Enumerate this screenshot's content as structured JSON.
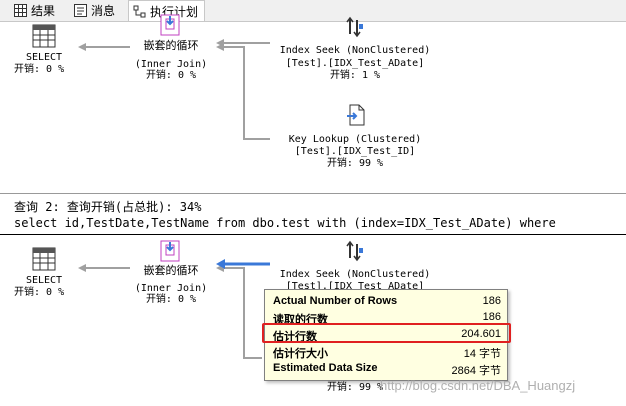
{
  "tabs": [
    {
      "label": "结果",
      "icon": "grid-icon"
    },
    {
      "label": "消息",
      "icon": "message-icon"
    },
    {
      "label": "执行计划",
      "icon": "plan-icon"
    }
  ],
  "plan1": {
    "select": {
      "title": "SELECT",
      "cost": "开销: 0 %"
    },
    "loop": {
      "title": "嵌套的循环",
      "sub": "(Inner Join)",
      "cost": "开销: 0 %"
    },
    "seek": {
      "title": "Index Seek (NonClustered)",
      "object": "[Test].[IDX_Test_ADate]",
      "cost": "开销: 1 %"
    },
    "lookup": {
      "title": "Key Lookup (Clustered)",
      "object": "[Test].[IDX_Test_ID]",
      "cost": "开销: 99 %"
    }
  },
  "query2": {
    "header": "查询 2: 查询开销(占总批): 34%",
    "sql": "select id,TestDate,TestName from dbo.test with (index=IDX_Test_ADate) where"
  },
  "plan2": {
    "select": {
      "title": "SELECT",
      "cost": "开销: 0 %"
    },
    "loop": {
      "title": "嵌套的循环",
      "sub": "(Inner Join)",
      "cost": "开销: 0 %"
    },
    "seek": {
      "title": "Index Seek (NonClustered)",
      "object_partial": "[Test].[IDX_Test_ADate]"
    },
    "lookup": {
      "cost": "开销: 99 %"
    }
  },
  "tooltip": {
    "rows": [
      {
        "key": "Actual Number of Rows",
        "value": "186"
      },
      {
        "key": "读取的行数",
        "value": "186"
      },
      {
        "key": "估计行数",
        "value": "204.601"
      },
      {
        "key": "估计行大小",
        "value": "14 字节"
      },
      {
        "key": "Estimated Data Size",
        "value": "2864 字节"
      }
    ]
  },
  "watermark": "http://blog.csdn.net/DBA_Huangzj",
  "colors": {
    "highlight": "#e02020",
    "tooltip_bg": "#ffffe1",
    "arrow_gray": "#a0a0a0",
    "selected_arrow": "#3a78d8"
  }
}
